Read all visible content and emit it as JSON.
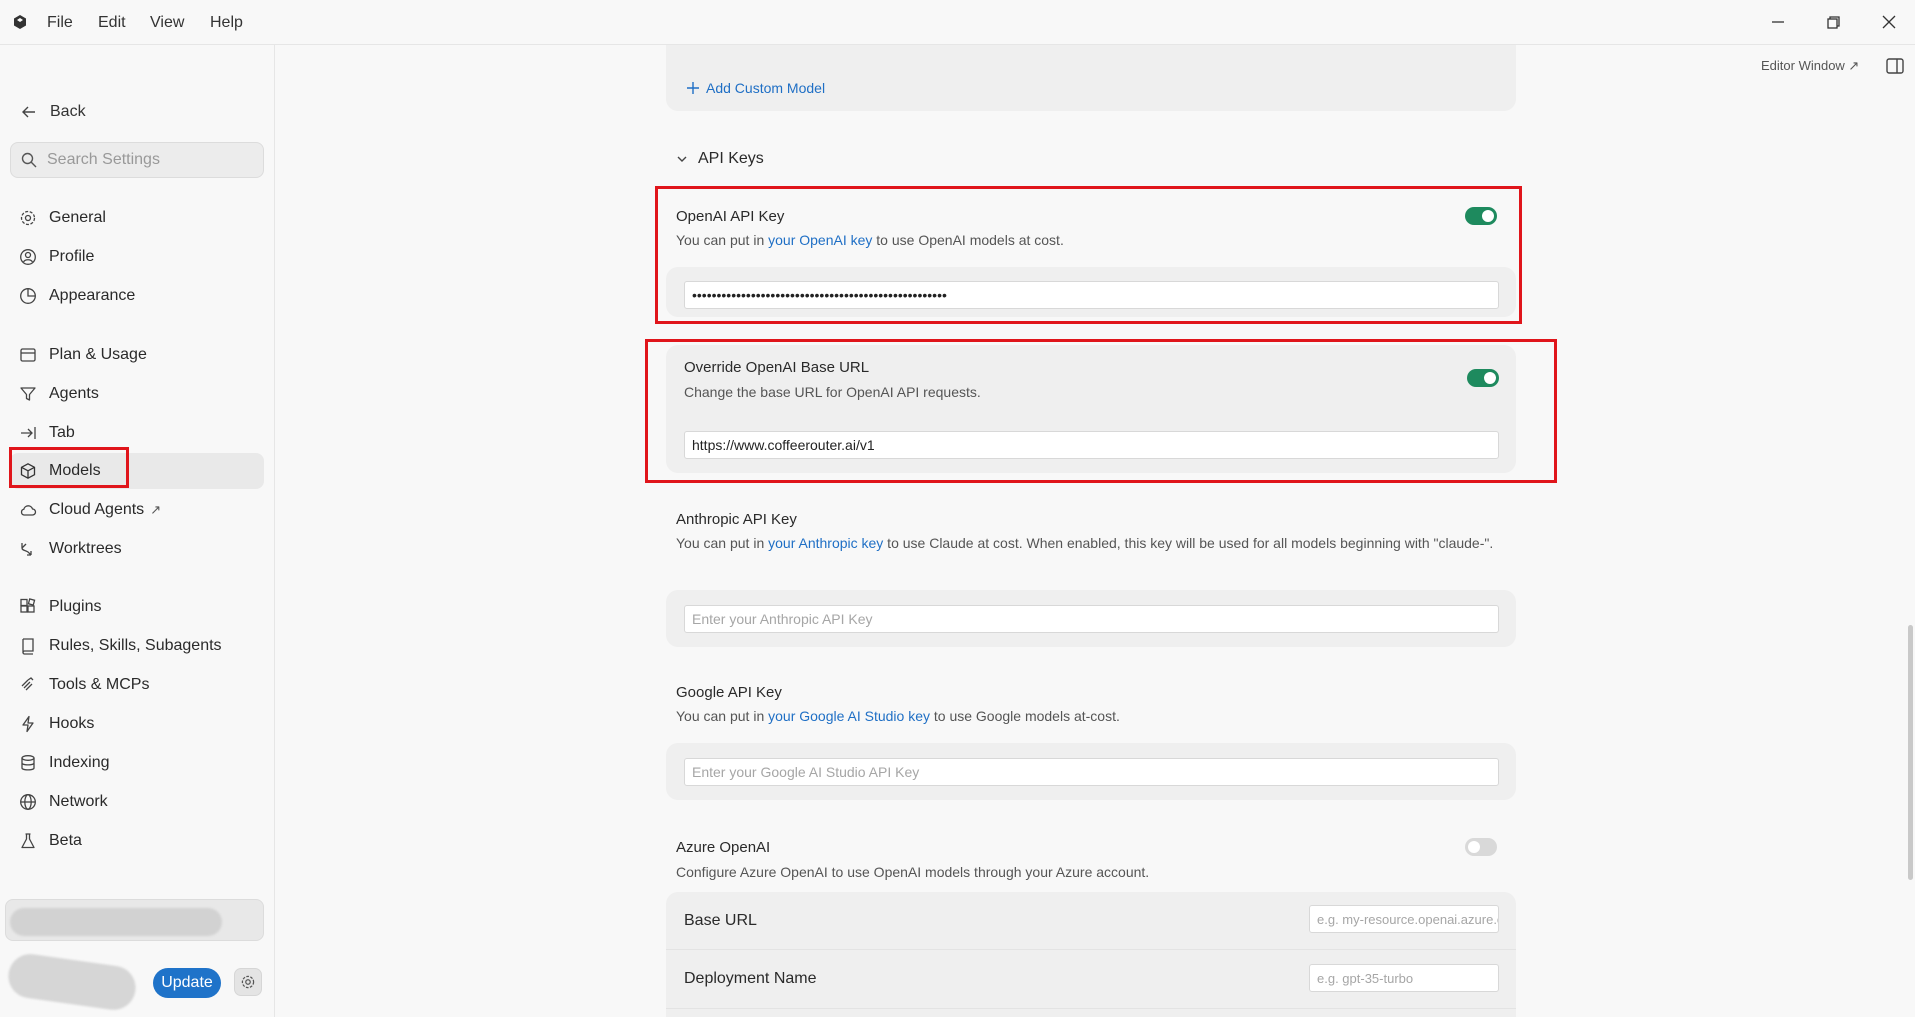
{
  "menu": {
    "file": "File",
    "edit": "Edit",
    "view": "View",
    "help": "Help"
  },
  "header": {
    "editor_window": "Editor Window ↗"
  },
  "sidebar": {
    "back": "Back",
    "search_placeholder": "Search Settings",
    "items": [
      {
        "label": "General",
        "icon": "gear-icon"
      },
      {
        "label": "Profile",
        "icon": "user-circle-icon"
      },
      {
        "label": "Appearance",
        "icon": "palette-icon"
      },
      {
        "label": "Plan & Usage",
        "icon": "card-icon"
      },
      {
        "label": "Agents",
        "icon": "funnel-icon"
      },
      {
        "label": "Tab",
        "icon": "tab-arrow-icon"
      },
      {
        "label": "Models",
        "icon": "cube-icon",
        "active": true
      },
      {
        "label": "Cloud Agents",
        "icon": "cloud-icon",
        "external": "↗"
      },
      {
        "label": "Worktrees",
        "icon": "branch-icon"
      },
      {
        "label": "Plugins",
        "icon": "puzzle-icon"
      },
      {
        "label": "Rules, Skills, Subagents",
        "icon": "book-icon"
      },
      {
        "label": "Tools & MCPs",
        "icon": "tools-icon"
      },
      {
        "label": "Hooks",
        "icon": "bolt-icon"
      },
      {
        "label": "Indexing",
        "icon": "database-icon"
      },
      {
        "label": "Network",
        "icon": "globe-icon"
      },
      {
        "label": "Beta",
        "icon": "flask-icon"
      }
    ],
    "update_label": "Update"
  },
  "main": {
    "add_custom_model": "Add Custom Model",
    "api_keys_section": "API Keys",
    "openai": {
      "label": "OpenAI API Key",
      "desc_pre": "You can put in ",
      "desc_link": "your OpenAI key",
      "desc_post": " to use OpenAI models at cost.",
      "value": "••••••••••••••••••••••••••••••••••••••••••••••••••••",
      "enabled": true
    },
    "override": {
      "label": "Override OpenAI Base URL",
      "desc": "Change the base URL for OpenAI API requests.",
      "value": "https://www.coffeerouter.ai/v1",
      "enabled": true
    },
    "anthropic": {
      "label": "Anthropic API Key",
      "desc_pre": "You can put in ",
      "desc_link": "your Anthropic key",
      "desc_post": " to use Claude at cost. When enabled, this key will be used for all models beginning with \"claude-\".",
      "placeholder": "Enter your Anthropic API Key"
    },
    "google": {
      "label": "Google API Key",
      "desc_pre": "You can put in ",
      "desc_link": "your Google AI Studio key",
      "desc_post": " to use Google models at-cost.",
      "placeholder": "Enter your Google AI Studio API Key"
    },
    "azure": {
      "label": "Azure OpenAI",
      "desc": "Configure Azure OpenAI to use OpenAI models through your Azure account.",
      "enabled": false,
      "base_url_label": "Base URL",
      "base_url_placeholder": "e.g. my-resource.openai.azure.com",
      "deployment_label": "Deployment Name",
      "deployment_placeholder": "e.g. gpt-35-turbo"
    }
  },
  "colors": {
    "accent": "#1f73c9",
    "toggle_on": "#1e8a5e",
    "highlight": "#e0151b",
    "link": "#1f6fc5"
  }
}
